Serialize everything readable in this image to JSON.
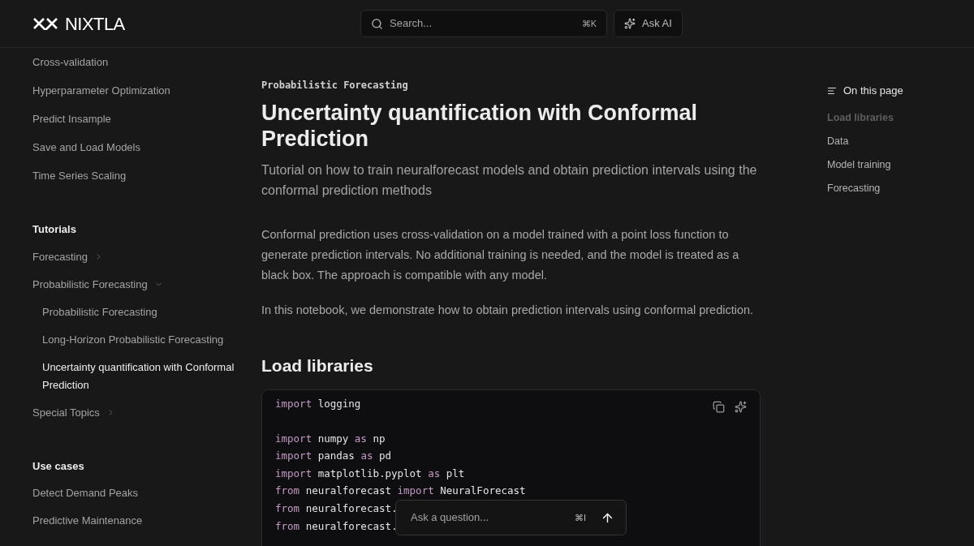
{
  "header": {
    "logo": "NIXTLA",
    "search": {
      "placeholder": "Search...",
      "shortcut": "⌘K"
    },
    "ask_ai": "Ask AI"
  },
  "sidebar": {
    "items": [
      {
        "label": "Cross-validation",
        "selected": false
      },
      {
        "label": "Hyperparameter Optimization",
        "selected": false
      },
      {
        "label": "Predict Insample",
        "selected": false
      },
      {
        "label": "Save and Load Models",
        "selected": false
      },
      {
        "label": "Time Series Scaling",
        "selected": false
      }
    ],
    "sections": [
      {
        "title": "Tutorials",
        "items": [
          {
            "label": "Forecasting",
            "selected": false,
            "expanded": false
          },
          {
            "label": "Probabilistic Forecasting",
            "selected": false,
            "expanded": true,
            "children": [
              {
                "label": "Probabilistic Forecasting",
                "selected": false
              },
              {
                "label": "Long-Horizon Probabilistic Forecasting",
                "selected": false
              },
              {
                "label": "Uncertainty quantification with Conformal Prediction",
                "selected": true
              }
            ]
          },
          {
            "label": "Special Topics",
            "selected": false,
            "expanded": false
          }
        ]
      },
      {
        "title": "Use cases",
        "items": [
          {
            "label": "Detect Demand Peaks",
            "selected": false
          },
          {
            "label": "Predictive Maintenance",
            "selected": false
          }
        ]
      }
    ]
  },
  "article": {
    "eyebrow": "Probabilistic Forecasting",
    "title": "Uncertainty quantification with Conformal Prediction",
    "subtitle": "Tutorial on how to train neuralforecast models and obtain prediction intervals using the conformal prediction methods",
    "paragraphs": [
      "Conformal prediction uses cross-validation on a model trained with a point loss function to generate prediction intervals. No additional training is needed, and the model is treated as a black box. The approach is compatible with any model.",
      "In this notebook, we demonstrate how to obtain prediction intervals using conformal prediction."
    ],
    "heading": "Load libraries",
    "code_blocks": [
      [
        [
          {
            "t": "import",
            "keyword": true
          },
          {
            "t": " logging",
            "keyword": false
          }
        ]
      ],
      [
        [
          {
            "t": "import",
            "keyword": true
          },
          {
            "t": " numpy ",
            "keyword": false
          },
          {
            "t": "as",
            "keyword": true
          },
          {
            "t": " np",
            "keyword": false
          }
        ],
        [
          {
            "t": "import",
            "keyword": true
          },
          {
            "t": " pandas ",
            "keyword": false
          },
          {
            "t": "as",
            "keyword": true
          },
          {
            "t": " pd",
            "keyword": false
          }
        ],
        [
          {
            "t": "import",
            "keyword": true
          },
          {
            "t": " matplotlib.pyplot ",
            "keyword": false
          },
          {
            "t": "as",
            "keyword": true
          },
          {
            "t": " plt",
            "keyword": false
          }
        ],
        [
          {
            "t": "from",
            "keyword": true
          },
          {
            "t": " neuralforecast ",
            "keyword": false
          },
          {
            "t": "import",
            "keyword": true
          },
          {
            "t": " NeuralForecast",
            "keyword": false
          }
        ],
        [
          {
            "t": "from",
            "keyword": true
          },
          {
            "t": " neuralforecast.",
            "keyword": false
          }
        ],
        [
          {
            "t": "from",
            "keyword": true
          },
          {
            "t": " neuralforecast.",
            "keyword": false
          }
        ]
      ]
    ]
  },
  "toc": {
    "title": "On this page",
    "items": [
      {
        "label": "Load libraries",
        "selected": true
      },
      {
        "label": "Data",
        "selected": false
      },
      {
        "label": "Model training",
        "selected": false
      },
      {
        "label": "Forecasting",
        "selected": false
      }
    ]
  },
  "ask_box": {
    "placeholder": "Ask a question...",
    "shortcut": "⌘I"
  }
}
